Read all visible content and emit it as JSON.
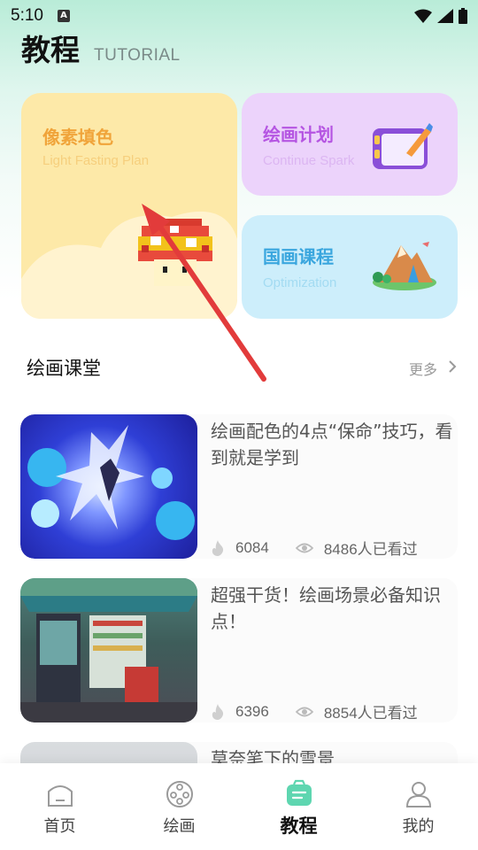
{
  "status": {
    "time": "5:10",
    "notif_letter": "A"
  },
  "header": {
    "title": "教程",
    "subtitle": "TUTORIAL"
  },
  "cards": [
    {
      "title": "像素填色",
      "subtitle": "Light Fasting Plan"
    },
    {
      "title": "绘画计划",
      "subtitle": "Continue Spark"
    },
    {
      "title": "国画课程",
      "subtitle": "Optimization"
    }
  ],
  "section": {
    "title": "绘画课堂",
    "more": "更多"
  },
  "lessons": [
    {
      "title": "绘画配色的4点“保命”技巧，看到就是学到",
      "likes": "6084",
      "views": "8486人已看过"
    },
    {
      "title": "超强干货！绘画场景必备知识点！",
      "likes": "6396",
      "views": "8854人已看过"
    },
    {
      "title": "莫奈笔下的雪景"
    }
  ],
  "tabs": [
    {
      "label": "首页",
      "icon": "home-icon"
    },
    {
      "label": "绘画",
      "icon": "palette-icon"
    },
    {
      "label": "教程",
      "icon": "tutorial-icon",
      "active": true
    },
    {
      "label": "我的",
      "icon": "profile-icon"
    }
  ],
  "colors": {
    "pixel_card": "#fde9a8",
    "plan_card": "#ecd3fb",
    "guohua_card": "#cdeefb",
    "pixel_title": "#f0a43a",
    "plan_title": "#b555e2",
    "guohua_title": "#3aa6de",
    "tab_active": "#5ed6b0",
    "arrow": "#e23b3b"
  }
}
